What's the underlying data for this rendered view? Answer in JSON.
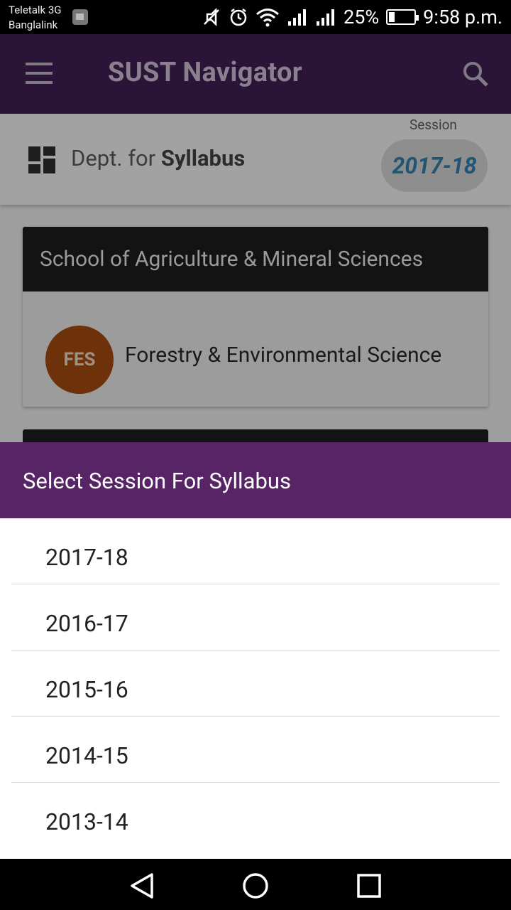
{
  "status_bar": {
    "carrier_line1": "Teletalk 3G",
    "carrier_line2": "Banglalink",
    "battery": "25%",
    "time": "9:58 p.m."
  },
  "app_bar": {
    "title": "SUST Navigator"
  },
  "dept_bar": {
    "prefix": "Dept. for",
    "emphasis": "Syllabus",
    "session_label": "Session",
    "session_value": "2017-18"
  },
  "school_card": {
    "title": "School of Agriculture & Mineral Sciences",
    "departments": [
      {
        "badge": "FES",
        "name": "Forestry & Environmental Science"
      }
    ]
  },
  "dialog": {
    "title": "Select Session For Syllabus",
    "options": [
      "2017-18",
      "2016-17",
      "2015-16",
      "2014-15",
      "2013-14"
    ]
  },
  "colors": {
    "primary": "#572565",
    "badge": "#a34d0e",
    "session_text": "#215574"
  }
}
